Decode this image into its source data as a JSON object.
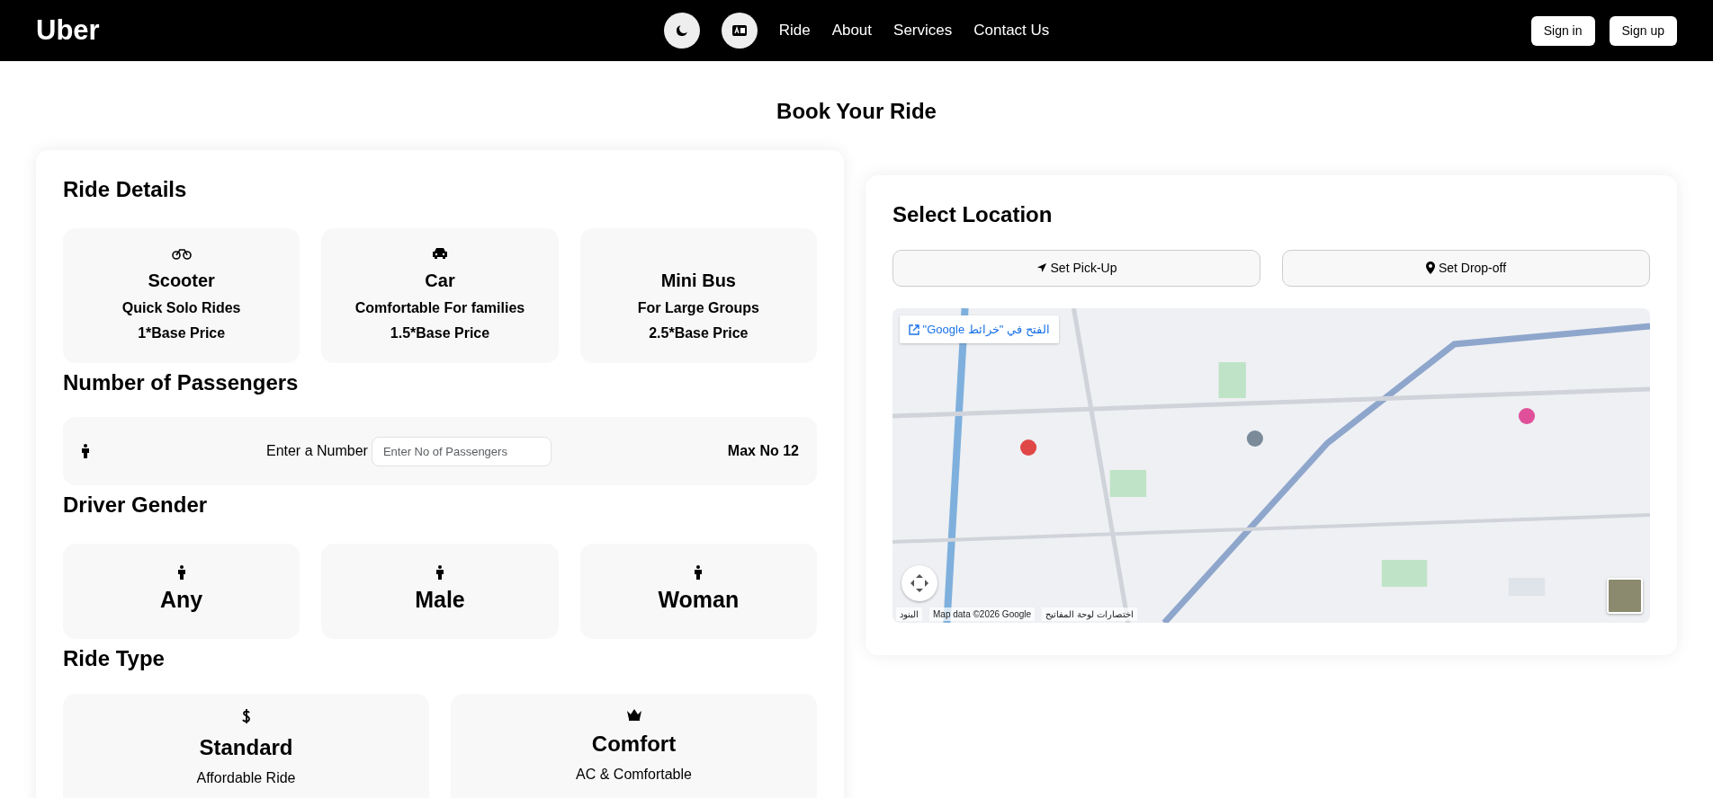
{
  "navbar": {
    "brand": "Uber",
    "links": [
      "Ride",
      "About",
      "Services",
      "Contact Us"
    ],
    "buttons": [
      "Sign in",
      "Sign up"
    ]
  },
  "page_title": "Book Your Ride",
  "ride_details": {
    "title": "Ride Details",
    "vehicles": [
      {
        "kind": "scooter",
        "name": "Scooter",
        "description": "Quick Solo Rides",
        "price": "1*Base Price"
      },
      {
        "kind": "car",
        "name": "Car",
        "description": "Comfortable For families",
        "price": "1.5*Base Price"
      },
      {
        "kind": "bus",
        "name": "Mini Bus",
        "description": "For Large Groups",
        "price": "2.5*Base Price"
      }
    ]
  },
  "passengers": {
    "title": "Number of Passengers",
    "label": "Enter a Number",
    "placeholder": "Enter No of Passengers",
    "max": "Max No 12"
  },
  "driver_gender": {
    "title": "Driver Gender",
    "options": [
      "Any",
      "Male",
      "Woman"
    ]
  },
  "ride_type": {
    "title": "Ride Type",
    "options": [
      {
        "kind": "standard",
        "name": "Standard",
        "description": "Affordable Ride"
      },
      {
        "kind": "comfort",
        "name": "Comfort",
        "description": "AC & Comfortable"
      }
    ]
  },
  "location": {
    "title": "Select Location",
    "buttons": [
      {
        "kind": "pickup",
        "label": "Set Pick-Up"
      },
      {
        "kind": "dropoff",
        "label": "Set Drop-off"
      }
    ],
    "map": {
      "kind": "picture",
      "open_link": "الفتح في \"خرائط Google\"",
      "terms": "البنود",
      "attribution": "Map data ©2026 Google",
      "shortcuts": "اختصارات لوحة المفاتيح"
    }
  }
}
